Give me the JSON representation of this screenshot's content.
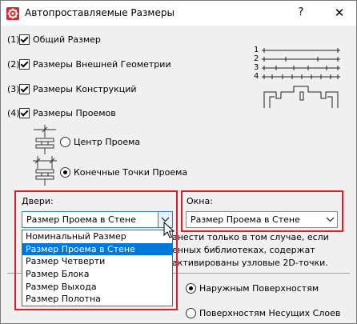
{
  "window": {
    "title": "Автопроставляемые Размеры",
    "help_label": "?",
    "close_label": "✕",
    "icon": "gear-icon"
  },
  "options": [
    {
      "num": "(1)",
      "label": "Общий Размер",
      "checked": true
    },
    {
      "num": "(2)",
      "label": "Размеры Внешней Геометрии",
      "checked": true
    },
    {
      "num": "(3)",
      "label": "Размеры Конструкций",
      "checked": true
    },
    {
      "num": "(4)",
      "label": "Размеры Проемов",
      "checked": true
    }
  ],
  "opening_mode": {
    "center": "Центр Проема",
    "ends": "Конечные Точки Проема",
    "selected": "ends"
  },
  "legend": {
    "numbers": [
      "1",
      "2",
      "3",
      "4"
    ]
  },
  "doors": {
    "label": "Двери:",
    "value": "Размер Проема в Стене",
    "options": [
      "Номинальный Размер",
      "Размер Проема в Стене",
      "Размер Четверти",
      "Размер Блока",
      "Размер Выхода",
      "Размер Полотна"
    ],
    "selected_index": 1
  },
  "windows": {
    "label": "Окна:",
    "value": "Размер Проема в Стене"
  },
  "note": {
    "line1": "анести только в том случае, если",
    "line2": "енных библиотеках, содержат",
    "line3": "активированы узловые 2D-точки."
  },
  "surfaces": {
    "outer": "Наружным Поверхностям",
    "core": "Поверхностям Несущих Слоев",
    "selected": "outer"
  },
  "colors": {
    "highlight": "#e51c23",
    "selection": "#0078d7"
  }
}
